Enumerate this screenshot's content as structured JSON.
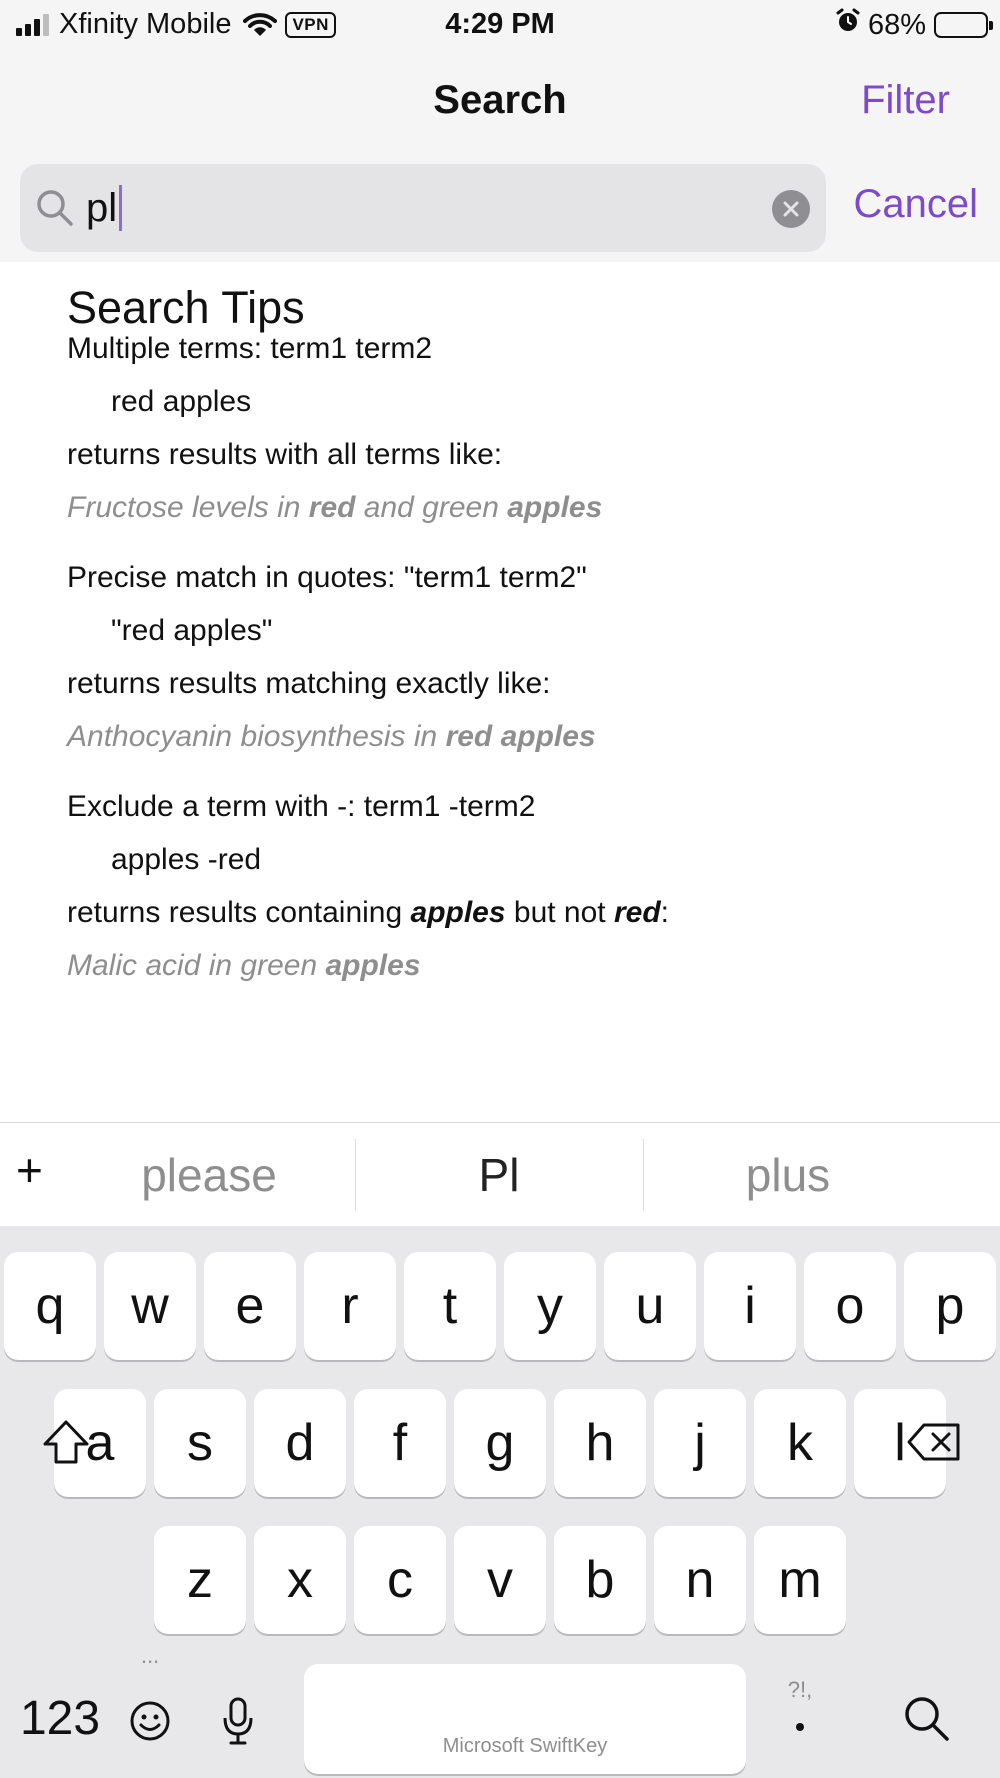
{
  "status_bar": {
    "carrier": "Xfinity Mobile",
    "vpn": "VPN",
    "time": "4:29 PM",
    "battery": "68%",
    "battery_level": 0.68,
    "signal_bars": 3
  },
  "nav": {
    "title": "Search",
    "filter_label": "Filter"
  },
  "search": {
    "value": "pl",
    "cancel_label": "Cancel"
  },
  "tips": {
    "title": "Search Tips",
    "multiple": {
      "heading": "Multiple terms: term1 term2",
      "example": "red apples",
      "description": "returns results with all terms like:",
      "result_parts": [
        "Fructose levels in ",
        "red",
        " and green ",
        "apples"
      ]
    },
    "precise": {
      "heading": "Precise match in quotes: \"term1 term2\"",
      "example": "\"red apples\"",
      "description": "returns results matching exactly like:",
      "result_parts": [
        "Anthocyanin biosynthesis in ",
        "red apples"
      ]
    },
    "exclude": {
      "heading": "Exclude a term with -: term1 -term2",
      "example": "apples -red",
      "description_parts": [
        "returns results containing ",
        "apples",
        " but not ",
        "red",
        ":"
      ],
      "result_parts": [
        "Malic acid in green ",
        "apples"
      ]
    }
  },
  "suggestions": {
    "plus": "+",
    "items": [
      "please",
      "Pl",
      "plus"
    ]
  },
  "keyboard": {
    "row1": [
      "q",
      "w",
      "e",
      "r",
      "t",
      "y",
      "u",
      "i",
      "o",
      "p"
    ],
    "row2": [
      "a",
      "s",
      "d",
      "f",
      "g",
      "h",
      "j",
      "k",
      "l"
    ],
    "row3": [
      "z",
      "x",
      "c",
      "v",
      "b",
      "n",
      "m"
    ],
    "numbers_label": "123",
    "more_dots": "...",
    "punct_label": "?!,",
    "space_label": "Microsoft SwiftKey"
  },
  "colors": {
    "accent": "#7e4bc8",
    "caret": "#8e6bd3",
    "example_text": "#8e8e8e"
  }
}
